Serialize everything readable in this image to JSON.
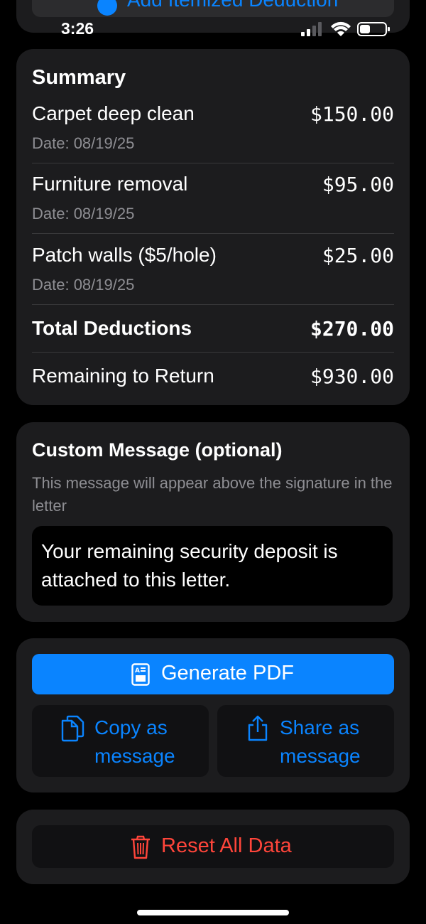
{
  "status_bar": {
    "time": "3:26"
  },
  "top_card": {
    "add_button_label": "Add Itemized Deduction"
  },
  "summary": {
    "title": "Summary",
    "items": [
      {
        "name": "Carpet deep clean",
        "amount": "$150.00",
        "date": "Date: 08/19/25"
      },
      {
        "name": "Furniture removal",
        "amount": "$95.00",
        "date": "Date: 08/19/25"
      },
      {
        "name": "Patch walls ($5/hole)",
        "amount": "$25.00",
        "date": "Date: 08/19/25"
      }
    ],
    "total_label": "Total Deductions",
    "total_amount": "$270.00",
    "remaining_label": "Remaining to Return",
    "remaining_amount": "$930.00"
  },
  "custom_message": {
    "title": "Custom Message (optional)",
    "subtitle": "This message will appear above the signature in the letter",
    "value": "Your remaining security deposit is attached to this letter."
  },
  "actions": {
    "generate_pdf_label": "Generate PDF",
    "copy_label": "Copy as message",
    "share_label": "Share as message"
  },
  "reset": {
    "label": "Reset All Data"
  },
  "colors": {
    "accent": "#0a84ff",
    "destructive": "#ff453a",
    "card": "#1c1c1e",
    "secondary_text": "#8e8e93"
  },
  "icons": {
    "add": "plus-circle-icon",
    "generate_pdf": "document-icon",
    "copy": "copy-icon",
    "share": "share-icon",
    "reset": "trash-icon"
  }
}
